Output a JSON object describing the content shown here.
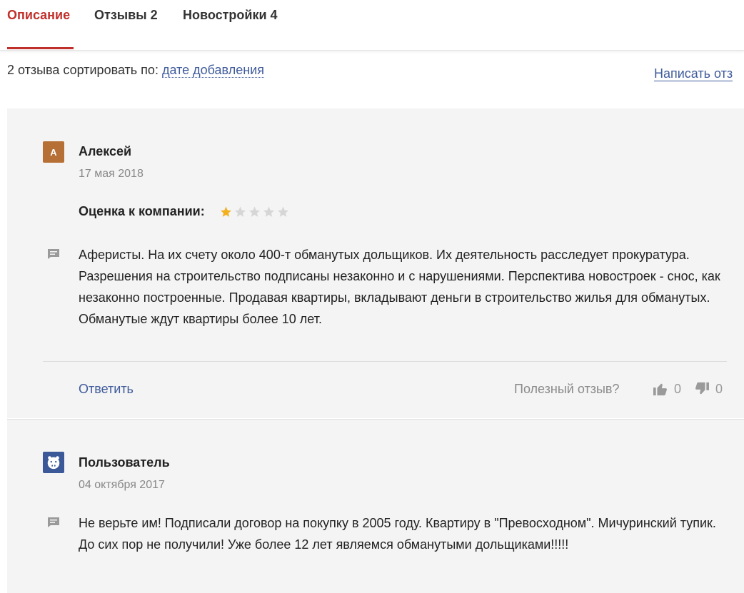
{
  "tabs": [
    {
      "label": "Описание",
      "active": true
    },
    {
      "label": "Отзывы 2",
      "active": false
    },
    {
      "label": "Новостройки 4",
      "active": false
    }
  ],
  "sort": {
    "prefix": "2 отзыва сортировать по:",
    "link": "дате добавления"
  },
  "write_review": "Написать отз",
  "reviews": [
    {
      "avatar_letter": "А",
      "avatar_color": "#b66f34",
      "author": "Алексей",
      "date": "17 мая 2018",
      "rating_label": "Оценка к компании:",
      "rating": 1,
      "rating_max": 5,
      "text": "Аферисты. На их счету около 400-т обманутых дольщиков. Их деятельность расследует прокуратура. Разрешения на строительство подписаны незаконно и с нарушениями. Перспектива новостроек - снос, как незаконно построенные. Продавая квартиры, вкладывают деньги в строительство жилья для обманутых. Обманутые ждут квартиры более 10 лет.",
      "reply_label": "Ответить",
      "helpful_label": "Полезный отзыв?",
      "likes": "0",
      "dislikes": "0"
    },
    {
      "avatar_icon": "hippo-icon",
      "avatar_color": "#3b5998",
      "author": "Пользователь",
      "date": "04 октября 2017",
      "text": "Не верьте им! Подписали договор на покупку в 2005 году. Квартиру в \"Превосходном\". Мичуринский тупик. До сих пор не получили! Уже более 12 лет являемся обманутыми дольщиками!!!!!"
    }
  ],
  "colors": {
    "accent": "#c0302b",
    "link": "#3f5b9b",
    "star_filled": "#f2b01e",
    "star_empty": "#d6d6d6"
  }
}
